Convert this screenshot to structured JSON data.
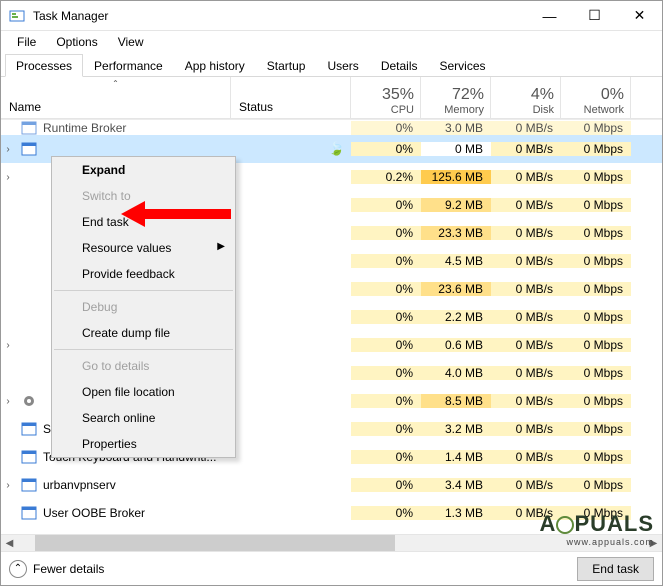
{
  "window": {
    "title": "Task Manager",
    "min_tooltip": "Minimize",
    "max_tooltip": "Maximize",
    "close_tooltip": "Close"
  },
  "menu": {
    "file": "File",
    "options": "Options",
    "view": "View"
  },
  "tabs": {
    "processes": "Processes",
    "performance": "Performance",
    "app_history": "App history",
    "startup": "Startup",
    "users": "Users",
    "details": "Details",
    "services": "Services"
  },
  "headers": {
    "name": "Name",
    "status": "Status",
    "cpu_pct": "35%",
    "cpu": "CPU",
    "mem_pct": "72%",
    "mem": "Memory",
    "disk_pct": "4%",
    "disk": "Disk",
    "net_pct": "0%",
    "net": "Network"
  },
  "rows": [
    {
      "name": "Runtime Broker",
      "chev": "",
      "icon": "app",
      "status": "",
      "cpu": "0%",
      "mem": "3.0 MB",
      "disk": "0 MB/s",
      "net": "0 Mbps",
      "selected": false,
      "mem_heat": "lo"
    },
    {
      "name": "",
      "chev": "›",
      "icon": "app",
      "status": "leaf",
      "cpu": "0%",
      "mem": "0 MB",
      "disk": "0 MB/s",
      "net": "0 Mbps",
      "selected": true,
      "mem_heat": "none"
    },
    {
      "name": "",
      "chev": "›",
      "icon": "",
      "status": "",
      "cpu": "0.2%",
      "mem": "125.6 MB",
      "disk": "0 MB/s",
      "net": "0 Mbps",
      "selected": false,
      "mem_heat": "hi"
    },
    {
      "name": "",
      "chev": "",
      "icon": "",
      "status": "",
      "cpu": "0%",
      "mem": "9.2 MB",
      "disk": "0 MB/s",
      "net": "0 Mbps",
      "selected": false,
      "mem_heat": "md"
    },
    {
      "name": "",
      "chev": "",
      "icon": "",
      "status": "",
      "cpu": "0%",
      "mem": "23.3 MB",
      "disk": "0 MB/s",
      "net": "0 Mbps",
      "selected": false,
      "mem_heat": "md"
    },
    {
      "name": "",
      "chev": "",
      "icon": "",
      "status": "",
      "cpu": "0%",
      "mem": "4.5 MB",
      "disk": "0 MB/s",
      "net": "0 Mbps",
      "selected": false,
      "mem_heat": "lo"
    },
    {
      "name": "",
      "chev": "",
      "icon": "",
      "status": "",
      "cpu": "0%",
      "mem": "23.6 MB",
      "disk": "0 MB/s",
      "net": "0 Mbps",
      "selected": false,
      "mem_heat": "md"
    },
    {
      "name": "",
      "chev": "",
      "icon": "",
      "status": "",
      "cpu": "0%",
      "mem": "2.2 MB",
      "disk": "0 MB/s",
      "net": "0 Mbps",
      "selected": false,
      "mem_heat": "lo"
    },
    {
      "name": "",
      "chev": "›",
      "icon": "",
      "status": "",
      "cpu": "0%",
      "mem": "0.6 MB",
      "disk": "0 MB/s",
      "net": "0 Mbps",
      "selected": false,
      "mem_heat": "lo"
    },
    {
      "name": "",
      "chev": "",
      "icon": "",
      "status": "",
      "cpu": "0%",
      "mem": "4.0 MB",
      "disk": "0 MB/s",
      "net": "0 Mbps",
      "selected": false,
      "mem_heat": "lo"
    },
    {
      "name": "",
      "chev": "›",
      "icon": "gear",
      "status": "",
      "cpu": "0%",
      "mem": "8.5 MB",
      "disk": "0 MB/s",
      "net": "0 Mbps",
      "selected": false,
      "mem_heat": "md"
    },
    {
      "name": "System Guard Runtime Monitor...",
      "chev": "",
      "icon": "app",
      "status": "",
      "cpu": "0%",
      "mem": "3.2 MB",
      "disk": "0 MB/s",
      "net": "0 Mbps",
      "selected": false,
      "mem_heat": "lo"
    },
    {
      "name": "Touch Keyboard and Handwriti...",
      "chev": "",
      "icon": "app",
      "status": "",
      "cpu": "0%",
      "mem": "1.4 MB",
      "disk": "0 MB/s",
      "net": "0 Mbps",
      "selected": false,
      "mem_heat": "lo"
    },
    {
      "name": "urbanvpnserv",
      "chev": "›",
      "icon": "app",
      "status": "",
      "cpu": "0%",
      "mem": "3.4 MB",
      "disk": "0 MB/s",
      "net": "0 Mbps",
      "selected": false,
      "mem_heat": "lo"
    },
    {
      "name": "User OOBE Broker",
      "chev": "",
      "icon": "app",
      "status": "",
      "cpu": "0%",
      "mem": "1.3 MB",
      "disk": "0 MB/s",
      "net": "0 Mbps",
      "selected": false,
      "mem_heat": "lo"
    }
  ],
  "context_menu": {
    "expand": "Expand",
    "switch_to": "Switch to",
    "end_task": "End task",
    "resource_values": "Resource values",
    "provide_feedback": "Provide feedback",
    "debug": "Debug",
    "create_dump": "Create dump file",
    "go_to_details": "Go to details",
    "open_file_location": "Open file location",
    "search_online": "Search online",
    "properties": "Properties"
  },
  "footer": {
    "fewer_details": "Fewer details",
    "end_task": "End task"
  },
  "watermark": {
    "brand": "A  PUALS",
    "sub": "www.appuals.com"
  }
}
